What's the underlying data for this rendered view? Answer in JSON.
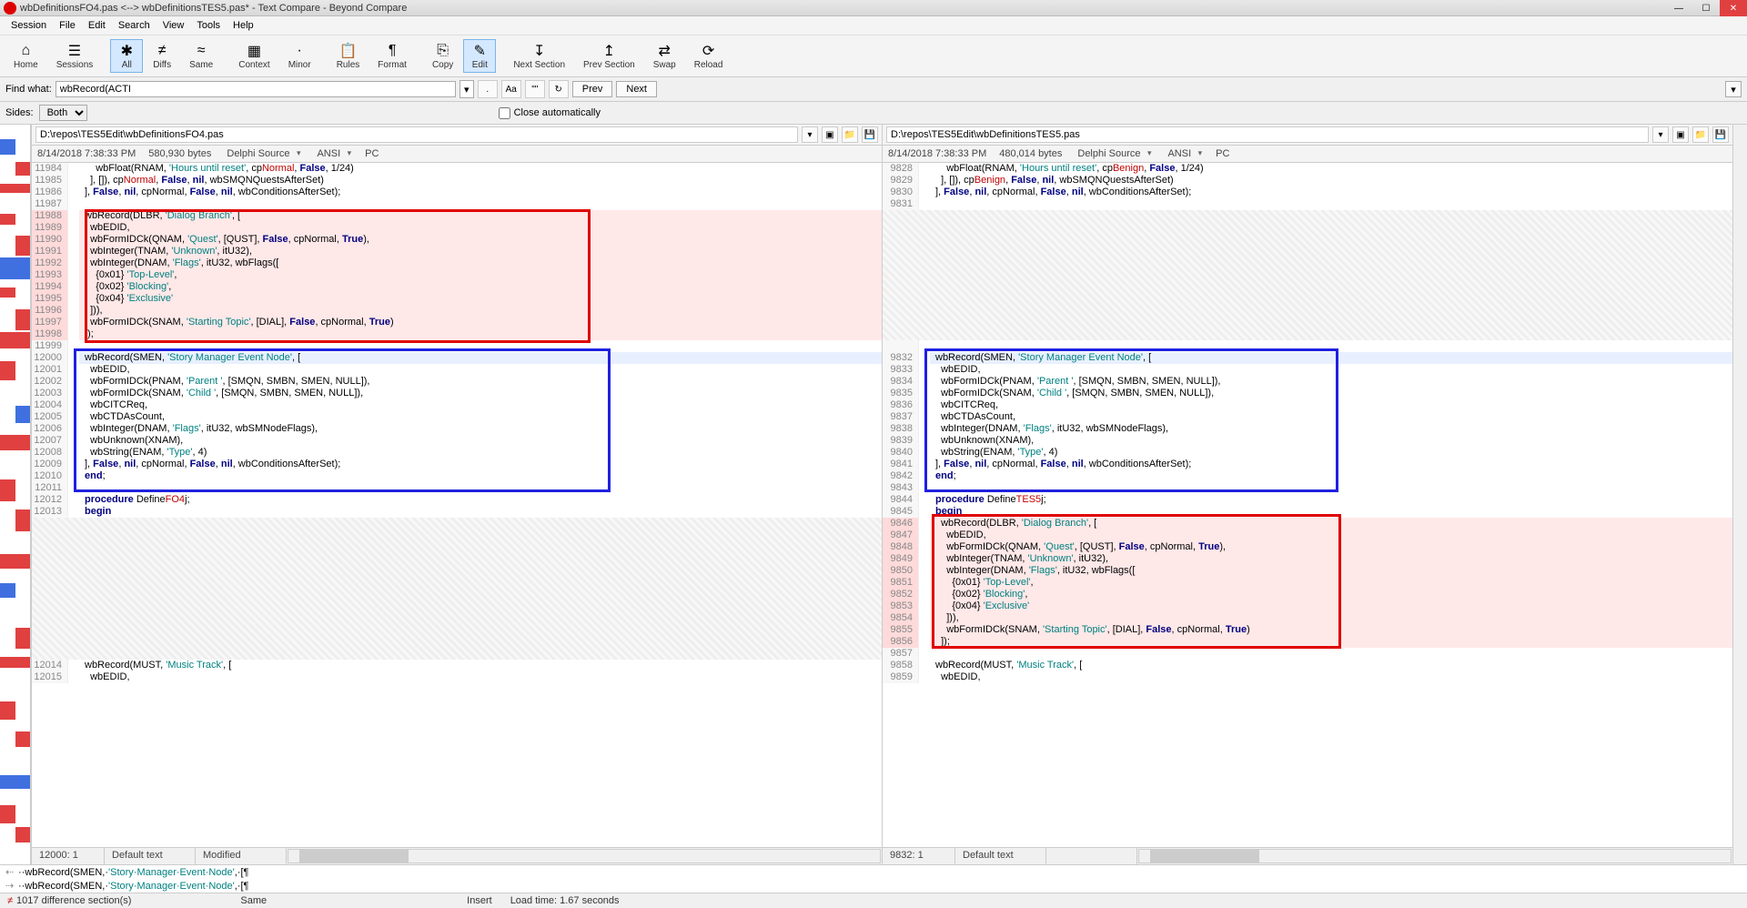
{
  "title": "wbDefinitionsFO4.pas <--> wbDefinitionsTES5.pas* - Text Compare - Beyond Compare",
  "menu": [
    "Session",
    "File",
    "Edit",
    "Search",
    "View",
    "Tools",
    "Help"
  ],
  "toolbar": [
    {
      "id": "home",
      "label": "Home",
      "icon": "⌂"
    },
    {
      "id": "sessions",
      "label": "Sessions",
      "icon": "☰"
    },
    {
      "id": "all",
      "label": "All",
      "icon": "✱",
      "active": true
    },
    {
      "id": "diffs",
      "label": "Diffs",
      "icon": "≠"
    },
    {
      "id": "same",
      "label": "Same",
      "icon": "≈"
    },
    {
      "id": "context",
      "label": "Context",
      "icon": "▦"
    },
    {
      "id": "minor",
      "label": "Minor",
      "icon": "·"
    },
    {
      "id": "rules",
      "label": "Rules",
      "icon": "📋"
    },
    {
      "id": "format",
      "label": "Format",
      "icon": "¶"
    },
    {
      "id": "copy",
      "label": "Copy",
      "icon": "⎘"
    },
    {
      "id": "edit",
      "label": "Edit",
      "icon": "✎",
      "active": true
    },
    {
      "id": "next",
      "label": "Next Section",
      "icon": "↧"
    },
    {
      "id": "prev",
      "label": "Prev Section",
      "icon": "↥"
    },
    {
      "id": "swap",
      "label": "Swap",
      "icon": "⇄"
    },
    {
      "id": "reload",
      "label": "Reload",
      "icon": "⟳"
    }
  ],
  "find": {
    "label": "Find what:",
    "value": "wbRecord(ACTI",
    "prev": "Prev",
    "next": "Next"
  },
  "sides": {
    "label": "Sides:",
    "value": "Both",
    "closeauto": "Close automatically"
  },
  "left": {
    "path": "D:\\repos\\TES5Edit\\wbDefinitionsFO4.pas",
    "timestamp": "8/14/2018 7:38:33 PM",
    "bytes": "580,930 bytes",
    "source": "Delphi Source",
    "encoding": "ANSI",
    "platform": "PC",
    "cursor": "12000: 1",
    "status1": "Default text",
    "status2": "Modified"
  },
  "right": {
    "path": "D:\\repos\\TES5Edit\\wbDefinitionsTES5.pas",
    "timestamp": "8/14/2018 7:38:33 PM",
    "bytes": "480,014 bytes",
    "source": "Delphi Source",
    "encoding": "ANSI",
    "platform": "PC",
    "cursor": "9832: 1",
    "status1": "Default text"
  },
  "leftLines": [
    {
      "n": 11984,
      "t": "    wbFloat(RNAM, 'Hours until reset', cpNormal, False, 1/24)",
      "diff": "word",
      "w": "Normal"
    },
    {
      "n": 11985,
      "t": "  ], []), cpNormal, False, nil, wbSMQNQuestsAfterSet)",
      "diff": "word",
      "w": "Normal"
    },
    {
      "n": 11986,
      "t": "], False, nil, cpNormal, False, nil, wbConditionsAfterSet);"
    },
    {
      "n": 11987,
      "t": ""
    },
    {
      "n": 11988,
      "t": "wbRecord(DLBR, 'Dialog Branch', [",
      "cls": "diff-red"
    },
    {
      "n": 11989,
      "t": "  wbEDID,",
      "cls": "diff-red"
    },
    {
      "n": 11990,
      "t": "  wbFormIDCk(QNAM, 'Quest', [QUST], False, cpNormal, True),",
      "cls": "diff-red"
    },
    {
      "n": 11991,
      "t": "  wbInteger(TNAM, 'Unknown', itU32),",
      "cls": "diff-red"
    },
    {
      "n": 11992,
      "t": "  wbInteger(DNAM, 'Flags', itU32, wbFlags([",
      "cls": "diff-red"
    },
    {
      "n": 11993,
      "t": "    {0x01} 'Top-Level',",
      "cls": "diff-red"
    },
    {
      "n": 11994,
      "t": "    {0x02} 'Blocking',",
      "cls": "diff-red"
    },
    {
      "n": 11995,
      "t": "    {0x04} 'Exclusive'",
      "cls": "diff-red"
    },
    {
      "n": 11996,
      "t": "  ])),",
      "cls": "diff-red"
    },
    {
      "n": 11997,
      "t": "  wbFormIDCk(SNAM, 'Starting Topic', [DIAL], False, cpNormal, True)",
      "cls": "diff-red"
    },
    {
      "n": 11998,
      "t": "]);",
      "cls": "diff-red"
    },
    {
      "n": 11999,
      "t": ""
    },
    {
      "n": 12000,
      "t": "wbRecord(SMEN, 'Story Manager Event Node', [",
      "cls": "sel"
    },
    {
      "n": 12001,
      "t": "  wbEDID,"
    },
    {
      "n": 12002,
      "t": "  wbFormIDCk(PNAM, 'Parent ', [SMQN, SMBN, SMEN, NULL]),"
    },
    {
      "n": 12003,
      "t": "  wbFormIDCk(SNAM, 'Child ', [SMQN, SMBN, SMEN, NULL]),"
    },
    {
      "n": 12004,
      "t": "  wbCITCReq,"
    },
    {
      "n": 12005,
      "t": "  wbCTDAsCount,"
    },
    {
      "n": 12006,
      "t": "  wbInteger(DNAM, 'Flags', itU32, wbSMNodeFlags),"
    },
    {
      "n": 12007,
      "t": "  wbUnknown(XNAM),"
    },
    {
      "n": 12008,
      "t": "  wbString(ENAM, 'Type', 4)"
    },
    {
      "n": 12009,
      "t": "], False, nil, cpNormal, False, nil, wbConditionsAfterSet);"
    },
    {
      "n": 12010,
      "t": "end;"
    },
    {
      "n": 12011,
      "t": ""
    },
    {
      "n": 12012,
      "t": "procedure DefineFO4j;",
      "diff": "word",
      "w": "FO4"
    },
    {
      "n": 12013,
      "t": "begin"
    },
    {
      "hatch": true,
      "rows": 12
    },
    {
      "n": 12014,
      "t": "wbRecord(MUST, 'Music Track', ["
    },
    {
      "n": 12015,
      "t": "  wbEDID,"
    }
  ],
  "rightLines": [
    {
      "n": 9828,
      "t": "    wbFloat(RNAM, 'Hours until reset', cpBenign, False, 1/24)",
      "diff": "word",
      "w": "Benign"
    },
    {
      "n": 9829,
      "t": "  ], []), cpBenign, False, nil, wbSMQNQuestsAfterSet)",
      "diff": "word",
      "w": "Benign"
    },
    {
      "n": 9830,
      "t": "], False, nil, cpNormal, False, nil, wbConditionsAfterSet);"
    },
    {
      "n": 9831,
      "t": ""
    },
    {
      "hatch": true,
      "rows": 11
    },
    {
      "blank": true
    },
    {
      "n": 9832,
      "t": "wbRecord(SMEN, 'Story Manager Event Node', [",
      "cls": "sel"
    },
    {
      "n": 9833,
      "t": "  wbEDID,"
    },
    {
      "n": 9834,
      "t": "  wbFormIDCk(PNAM, 'Parent ', [SMQN, SMBN, SMEN, NULL]),"
    },
    {
      "n": 9835,
      "t": "  wbFormIDCk(SNAM, 'Child ', [SMQN, SMBN, SMEN, NULL]),"
    },
    {
      "n": 9836,
      "t": "  wbCITCReq,"
    },
    {
      "n": 9837,
      "t": "  wbCTDAsCount,"
    },
    {
      "n": 9838,
      "t": "  wbInteger(DNAM, 'Flags', itU32, wbSMNodeFlags),"
    },
    {
      "n": 9839,
      "t": "  wbUnknown(XNAM),"
    },
    {
      "n": 9840,
      "t": "  wbString(ENAM, 'Type', 4)"
    },
    {
      "n": 9841,
      "t": "], False, nil, cpNormal, False, nil, wbConditionsAfterSet);"
    },
    {
      "n": 9842,
      "t": "end;"
    },
    {
      "n": 9843,
      "t": ""
    },
    {
      "n": 9844,
      "t": "procedure DefineTES5j;",
      "diff": "word",
      "w": "TES5"
    },
    {
      "n": 9845,
      "t": "begin"
    },
    {
      "n": 9846,
      "t": "  wbRecord(DLBR, 'Dialog Branch', [",
      "cls": "diff-red"
    },
    {
      "n": 9847,
      "t": "    wbEDID,",
      "cls": "diff-red"
    },
    {
      "n": 9848,
      "t": "    wbFormIDCk(QNAM, 'Quest', [QUST], False, cpNormal, True),",
      "cls": "diff-red"
    },
    {
      "n": 9849,
      "t": "    wbInteger(TNAM, 'Unknown', itU32),",
      "cls": "diff-red"
    },
    {
      "n": 9850,
      "t": "    wbInteger(DNAM, 'Flags', itU32, wbFlags([",
      "cls": "diff-red"
    },
    {
      "n": 9851,
      "t": "      {0x01} 'Top-Level',",
      "cls": "diff-red"
    },
    {
      "n": 9852,
      "t": "      {0x02} 'Blocking',",
      "cls": "diff-red"
    },
    {
      "n": 9853,
      "t": "      {0x04} 'Exclusive'",
      "cls": "diff-red"
    },
    {
      "n": 9854,
      "t": "    ])),",
      "cls": "diff-red"
    },
    {
      "n": 9855,
      "t": "    wbFormIDCk(SNAM, 'Starting Topic', [DIAL], False, cpNormal, True)",
      "cls": "diff-red"
    },
    {
      "n": 9856,
      "t": "  ]);",
      "cls": "diff-red"
    },
    {
      "n": 9857,
      "t": ""
    },
    {
      "n": 9858,
      "t": "wbRecord(MUST, 'Music Track', ["
    },
    {
      "n": 9859,
      "t": "  wbEDID,"
    }
  ],
  "bottomDiff": [
    "··wbRecord(SMEN,·'Story·Manager·Event·Node',·[¶",
    "··wbRecord(SMEN,·'Story·Manager·Event·Node',·[¶"
  ],
  "status": {
    "diffs": "1017 difference section(s)",
    "same": "Same",
    "insert": "Insert",
    "load": "Load time: 1.67 seconds"
  }
}
